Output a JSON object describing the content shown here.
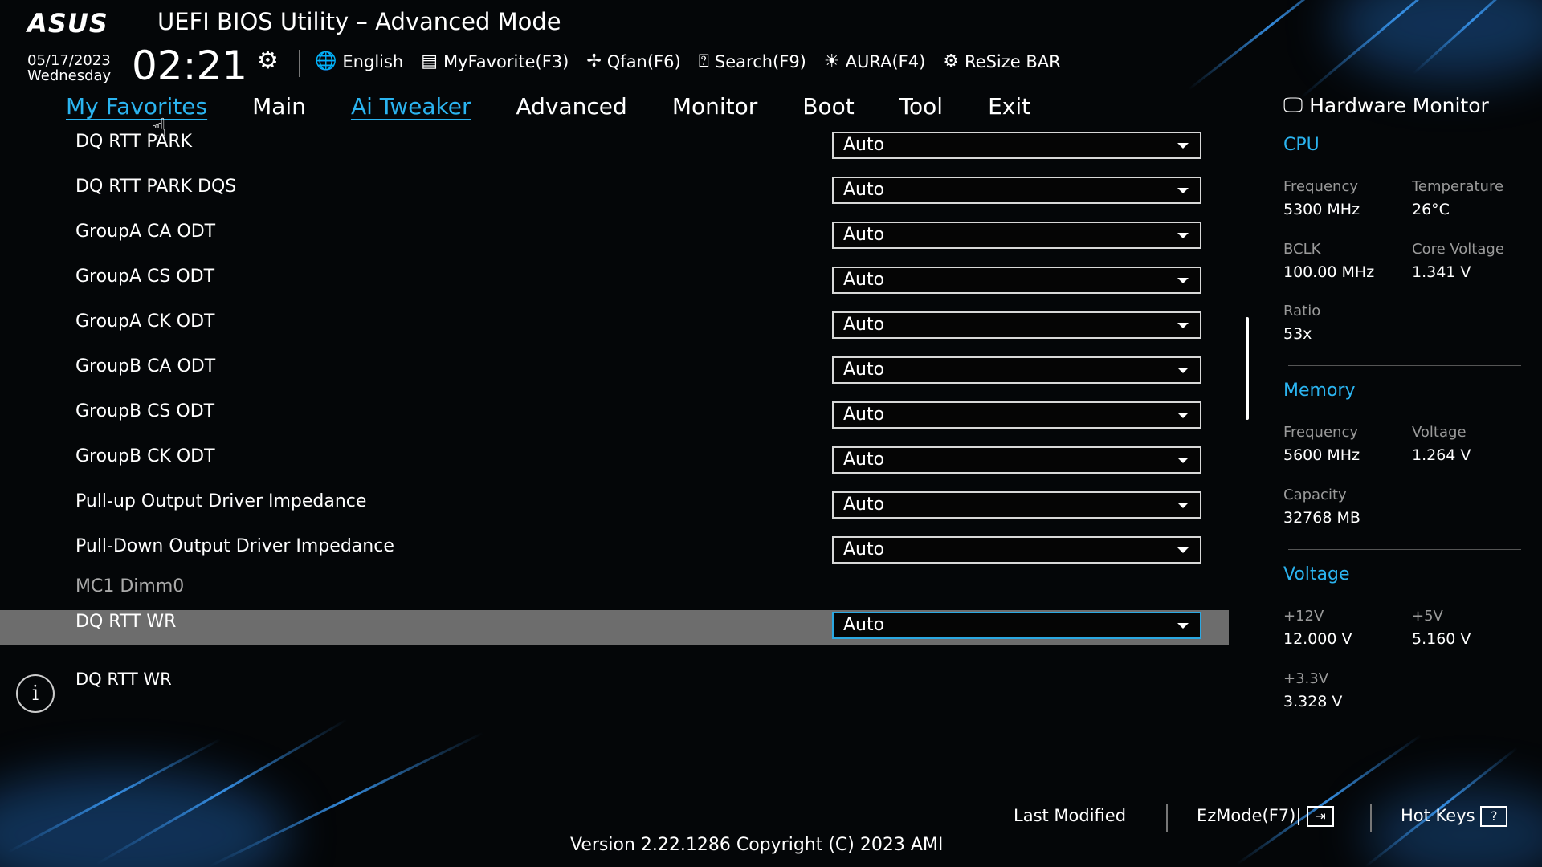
{
  "header": {
    "brand": "ASUS",
    "title": "UEFI BIOS Utility – Advanced Mode",
    "date": "05/17/2023",
    "weekday": "Wednesday",
    "time": "02:21"
  },
  "toolbar": [
    {
      "label": "English",
      "icon": "globe-icon"
    },
    {
      "label": "MyFavorite(F3)",
      "icon": "favorite-icon"
    },
    {
      "label": "Qfan(F6)",
      "icon": "fan-icon"
    },
    {
      "label": "Search(F9)",
      "icon": "search-icon"
    },
    {
      "label": "AURA(F4)",
      "icon": "aura-icon"
    },
    {
      "label": "ReSize BAR",
      "icon": "resize-bar-icon"
    }
  ],
  "tabs": [
    {
      "label": "My Favorites",
      "active": true
    },
    {
      "label": "Main",
      "active": false
    },
    {
      "label": "Ai Tweaker",
      "active": true
    },
    {
      "label": "Advanced",
      "active": false
    },
    {
      "label": "Monitor",
      "active": false
    },
    {
      "label": "Boot",
      "active": false
    },
    {
      "label": "Tool",
      "active": false
    },
    {
      "label": "Exit",
      "active": false
    }
  ],
  "settings": [
    {
      "label": "DQ RTT PARK",
      "value": "Auto"
    },
    {
      "label": "DQ RTT PARK DQS",
      "value": "Auto"
    },
    {
      "label": "GroupA CA ODT",
      "value": "Auto"
    },
    {
      "label": "GroupA CS ODT",
      "value": "Auto"
    },
    {
      "label": "GroupA CK ODT",
      "value": "Auto"
    },
    {
      "label": "GroupB CA ODT",
      "value": "Auto"
    },
    {
      "label": "GroupB CS ODT",
      "value": "Auto"
    },
    {
      "label": "GroupB CK ODT",
      "value": "Auto"
    },
    {
      "label": "Pull-up Output Driver Impedance",
      "value": "Auto"
    },
    {
      "label": "Pull-Down Output Driver Impedance",
      "value": "Auto"
    },
    {
      "label": "MC1 Dimm0",
      "section": true
    },
    {
      "label": "DQ RTT WR",
      "value": "Auto",
      "selected": true
    }
  ],
  "help": {
    "text": "DQ RTT WR"
  },
  "hardware_monitor": {
    "title": "Hardware Monitor",
    "cpu": {
      "heading": "CPU",
      "frequency_label": "Frequency",
      "frequency": "5300 MHz",
      "temperature_label": "Temperature",
      "temperature": "26°C",
      "bclk_label": "BCLK",
      "bclk": "100.00 MHz",
      "core_voltage_label": "Core Voltage",
      "core_voltage": "1.341 V",
      "ratio_label": "Ratio",
      "ratio": "53x"
    },
    "memory": {
      "heading": "Memory",
      "frequency_label": "Frequency",
      "frequency": "5600 MHz",
      "voltage_label": "Voltage",
      "voltage": "1.264 V",
      "capacity_label": "Capacity",
      "capacity": "32768 MB"
    },
    "voltage": {
      "heading": "Voltage",
      "v12_label": "+12V",
      "v12": "12.000 V",
      "v5_label": "+5V",
      "v5": "5.160 V",
      "v33_label": "+3.3V",
      "v33": "3.328 V"
    }
  },
  "footer": {
    "last_modified": "Last Modified",
    "ezmode": "EzMode(F7)|",
    "hotkeys": "Hot Keys",
    "version": "Version 2.22.1286 Copyright (C) 2023 AMI"
  },
  "colors": {
    "accent": "#2bb4f0",
    "background": "#040608",
    "selected_row": "#6d6d6d"
  }
}
